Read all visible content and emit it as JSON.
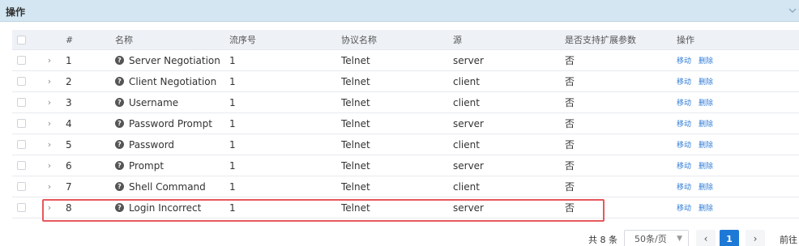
{
  "panel": {
    "title": "操作",
    "collapse_icon": "chevron-down-icon"
  },
  "table": {
    "columns": [
      "#",
      "名称",
      "流序号",
      "协议名称",
      "源",
      "是否支持扩展参数",
      "操作"
    ],
    "rows": [
      {
        "num": "1",
        "name": "Server Negotiation",
        "seq": "1",
        "protocol": "Telnet",
        "source": "server",
        "ext": "否",
        "move": "移动",
        "delete": "删除"
      },
      {
        "num": "2",
        "name": "Client Negotiation",
        "seq": "1",
        "protocol": "Telnet",
        "source": "client",
        "ext": "否",
        "move": "移动",
        "delete": "删除"
      },
      {
        "num": "3",
        "name": "Username",
        "seq": "1",
        "protocol": "Telnet",
        "source": "client",
        "ext": "否",
        "move": "移动",
        "delete": "删除"
      },
      {
        "num": "4",
        "name": "Password Prompt",
        "seq": "1",
        "protocol": "Telnet",
        "source": "server",
        "ext": "否",
        "move": "移动",
        "delete": "删除"
      },
      {
        "num": "5",
        "name": "Password",
        "seq": "1",
        "protocol": "Telnet",
        "source": "client",
        "ext": "否",
        "move": "移动",
        "delete": "删除"
      },
      {
        "num": "6",
        "name": "Prompt",
        "seq": "1",
        "protocol": "Telnet",
        "source": "server",
        "ext": "否",
        "move": "移动",
        "delete": "删除"
      },
      {
        "num": "7",
        "name": "Shell Command",
        "seq": "1",
        "protocol": "Telnet",
        "source": "client",
        "ext": "否",
        "move": "移动",
        "delete": "删除"
      },
      {
        "num": "8",
        "name": "Login Incorrect",
        "seq": "1",
        "protocol": "Telnet",
        "source": "server",
        "ext": "否",
        "move": "移动",
        "delete": "删除"
      }
    ]
  },
  "pagination": {
    "total": "共 8 条",
    "page_size": "50条/页",
    "current_page": "1",
    "goto_label": "前往"
  },
  "colors": {
    "header_bg": "#d3e6f1",
    "link": "#2f7bd6",
    "active_page": "#1e79d6",
    "highlight": "#e7585d"
  }
}
